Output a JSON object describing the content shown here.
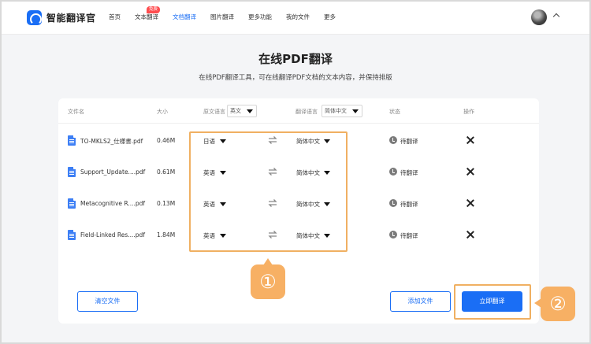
{
  "brand": {
    "name": "智能翻译官",
    "logo_icon": "translator-logo-icon",
    "accent": "#1a6ef5"
  },
  "nav": {
    "items": [
      {
        "label": "首页",
        "active": false
      },
      {
        "label": "文本翻译",
        "active": false,
        "badge": "免费"
      },
      {
        "label": "文档翻译",
        "active": true
      },
      {
        "label": "图片翻译",
        "active": false
      },
      {
        "label": "更多功能",
        "active": false
      },
      {
        "label": "我的文件",
        "active": false
      },
      {
        "label": "更多",
        "active": false
      }
    ]
  },
  "header": {
    "title": "在线PDF翻译",
    "subtitle": "在线PDF翻译工具，可在线翻译PDF文档的文本内容，并保持排版"
  },
  "table": {
    "columns": {
      "filename": "文件名",
      "size": "大小",
      "source_lang": "原文语言",
      "source_lang_value": "英文",
      "target_lang": "翻译语言",
      "target_lang_value": "简体中文",
      "status": "状态",
      "actions": "操作"
    },
    "rows": [
      {
        "name": "TO-MKLS2_仕様書.pdf",
        "size": "0.46M",
        "source": "日语",
        "target": "简体中文",
        "status": "待翻译"
      },
      {
        "name": "Support_Update....pdf",
        "size": "0.61M",
        "source": "英语",
        "target": "简体中文",
        "status": "待翻译"
      },
      {
        "name": "Metacognitive R....pdf",
        "size": "0.13M",
        "source": "英语",
        "target": "简体中文",
        "status": "待翻译"
      },
      {
        "name": "Field-Linked Res....pdf",
        "size": "1.84M",
        "source": "英语",
        "target": "简体中文",
        "status": "待翻译"
      }
    ]
  },
  "buttons": {
    "clear": "清空文件",
    "add": "添加文件",
    "translate": "立即翻译"
  },
  "annotations": {
    "step1": "①",
    "step2": "②",
    "color": "#f7b064"
  }
}
